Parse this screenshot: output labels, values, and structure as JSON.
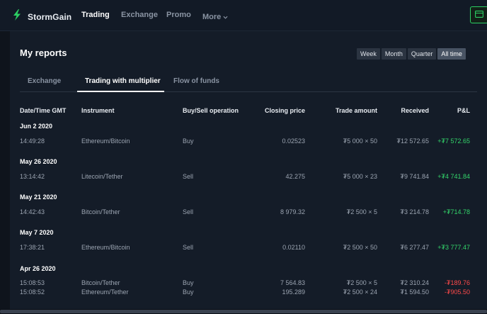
{
  "brand": {
    "name": "StormGain",
    "color": "#2ccf63"
  },
  "nav": {
    "items": [
      {
        "label": "Trading",
        "active": true
      },
      {
        "label": "Exchange",
        "active": false
      },
      {
        "label": "Promo",
        "active": false
      }
    ],
    "more": "More"
  },
  "page": {
    "title": "My reports"
  },
  "periods": {
    "items": [
      {
        "label": "Week",
        "active": false
      },
      {
        "label": "Month",
        "active": false
      },
      {
        "label": "Quarter",
        "active": false
      },
      {
        "label": "All time",
        "active": true
      }
    ]
  },
  "tabs": {
    "items": [
      {
        "label": "Exchange",
        "active": false
      },
      {
        "label": "Trading with multiplier",
        "active": true
      },
      {
        "label": "Flow of funds",
        "active": false
      }
    ]
  },
  "table": {
    "headers": {
      "datetime": "Date/Time GMT",
      "instrument": "Instrument",
      "operation": "Buy/Sell operation",
      "closing_price": "Closing price",
      "trade_amount": "Trade amount",
      "received": "Received",
      "pnl": "P&L"
    },
    "groups": [
      {
        "date": "Jun 2 2020",
        "rows": [
          {
            "time": "14:49:28",
            "instrument": "Ethereum/Bitcoin",
            "operation": "Buy",
            "closing_price": "0.02523",
            "trade_amount": "₮5 000 × 50",
            "received": "₮12 572.65",
            "pnl": "+₮7 572.65",
            "pnl_sign": "pos"
          }
        ]
      },
      {
        "date": "May 26 2020",
        "rows": [
          {
            "time": "13:14:42",
            "instrument": "Litecoin/Tether",
            "operation": "Sell",
            "closing_price": "42.275",
            "trade_amount": "₮5 000 × 23",
            "received": "₮9 741.84",
            "pnl": "+₮4 741.84",
            "pnl_sign": "pos"
          }
        ]
      },
      {
        "date": "May 21 2020",
        "rows": [
          {
            "time": "14:42:43",
            "instrument": "Bitcoin/Tether",
            "operation": "Sell",
            "closing_price": "8 979.32",
            "trade_amount": "₮2 500 × 5",
            "received": "₮3 214.78",
            "pnl": "+₮714.78",
            "pnl_sign": "pos"
          }
        ]
      },
      {
        "date": "May 7 2020",
        "rows": [
          {
            "time": "17:38:21",
            "instrument": "Ethereum/Bitcoin",
            "operation": "Sell",
            "closing_price": "0.02110",
            "trade_amount": "₮2 500 × 50",
            "received": "₮6 277.47",
            "pnl": "+₮3 777.47",
            "pnl_sign": "pos"
          }
        ]
      },
      {
        "date": "Apr 26 2020",
        "rows": [
          {
            "time": "15:08:53",
            "instrument": "Bitcoin/Tether",
            "operation": "Buy",
            "closing_price": "7 564.83",
            "trade_amount": "₮2 500 × 5",
            "received": "₮2 310.24",
            "pnl": "-₮189.76",
            "pnl_sign": "neg"
          },
          {
            "time": "15:08:52",
            "instrument": "Ethereum/Tether",
            "operation": "Buy",
            "closing_price": "195.289",
            "trade_amount": "₮2 500 × 24",
            "received": "₮1 594.50",
            "pnl": "-₮905.50",
            "pnl_sign": "neg"
          }
        ]
      }
    ]
  },
  "colors": {
    "positive": "#33d46a",
    "negative": "#ff4a4a",
    "accent": "#2ccf63"
  },
  "icons": {
    "logo": "stormgain-bolt-icon",
    "more": "chevron-down-icon",
    "wallet": "wallet-icon"
  }
}
